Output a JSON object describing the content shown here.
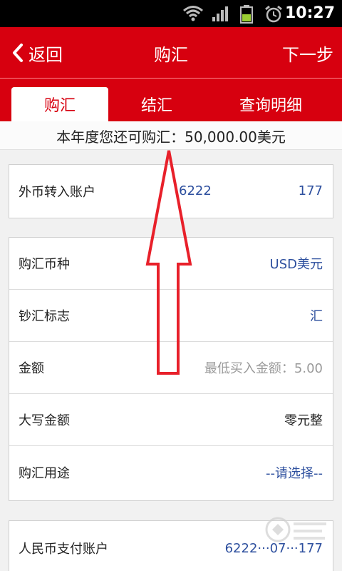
{
  "status_bar": {
    "time": "10:27",
    "icons": [
      "wifi-icon",
      "signal-icon",
      "battery-icon",
      "alarm-icon"
    ]
  },
  "header": {
    "back_label": "返回",
    "title": "购汇",
    "next_label": "下一步"
  },
  "tabs": [
    {
      "label": "购汇",
      "active": true
    },
    {
      "label": "结汇",
      "active": false
    },
    {
      "label": "查询明细",
      "active": false
    }
  ],
  "quota_text": "本年度您还可购汇：50,000.00美元",
  "foreign_account": {
    "label": "外币转入账户",
    "number_start": "6222",
    "number_end": "177"
  },
  "form": {
    "currency": {
      "label": "购汇币种",
      "value": "USD美元"
    },
    "cash_flag": {
      "label": "钞汇标志",
      "value": "汇"
    },
    "amount": {
      "label": "金额",
      "placeholder": "最低买入金额：5.00"
    },
    "amount_words": {
      "label": "大写金额",
      "value": "零元整"
    },
    "purpose": {
      "label": "购汇用途",
      "value": "--请选择--"
    }
  },
  "rmb_account": {
    "label": "人民币支付账户",
    "number": "6222···07···177"
  },
  "colors": {
    "brand_red": "#d7000f",
    "link_blue": "#2d4f9e",
    "annotation_red": "#e8202a"
  }
}
